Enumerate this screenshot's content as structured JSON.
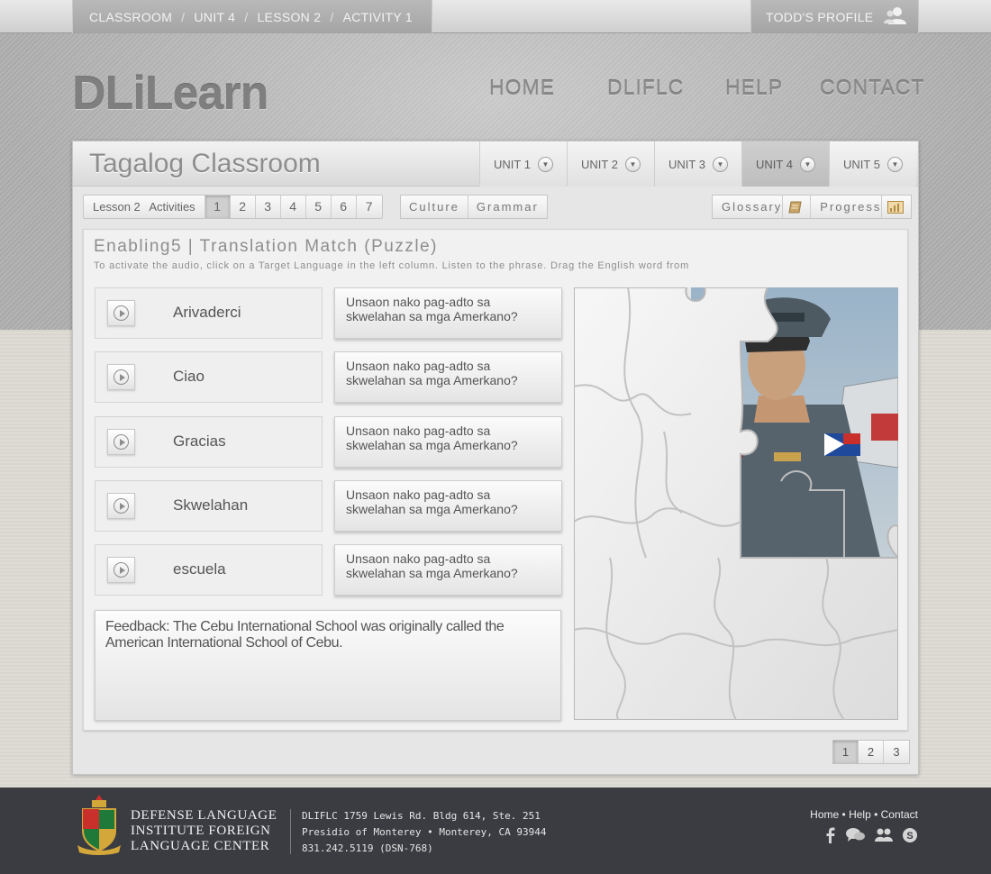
{
  "breadcrumb": {
    "items": [
      "CLASSROOM",
      "UNIT 4",
      "LESSON 2",
      "ACTIVITY 1"
    ],
    "separator": "/"
  },
  "profile": {
    "label": "TODD'S PROFILE",
    "icon": "user-icon"
  },
  "logo": {
    "text": "DLiLearn"
  },
  "nav": {
    "home": "HOME",
    "dliflc": "DLIFLC",
    "help": "HELP",
    "contact": "CONTACT"
  },
  "classroom": {
    "title": "Tagalog Classroom",
    "units": [
      "UNIT 1",
      "UNIT 2",
      "UNIT 3",
      "UNIT 4",
      "UNIT 5"
    ],
    "active_unit": "UNIT 4"
  },
  "activity_bar": {
    "lesson_label": "Lesson 2",
    "activities_label": "Activities",
    "numbers": [
      "1",
      "2",
      "3",
      "4",
      "5",
      "6",
      "7"
    ],
    "active": "1"
  },
  "tools": {
    "culture": "Culture",
    "grammar": "Grammar",
    "glossary": "Glossary",
    "progress": "Progress"
  },
  "activity": {
    "title": "Enabling5 | Translation Match (Puzzle)",
    "instructions": "To activate the audio, click on a Target Language in the left column. Listen to the phrase. Drag the English word from",
    "rows": [
      {
        "word": "Arivaderci",
        "phrase": "Unsaon nako pag-adto sa skwelahan sa mga Amerkano?"
      },
      {
        "word": "Ciao",
        "phrase": "Unsaon nako pag-adto sa skwelahan sa mga Amerkano?"
      },
      {
        "word": "Gracias",
        "phrase": "Unsaon nako pag-adto sa skwelahan sa mga Amerkano?"
      },
      {
        "word": "Skwelahan",
        "phrase": "Unsaon nako pag-adto sa skwelahan sa mga Amerkano?"
      },
      {
        "word": "escuela",
        "phrase": "Unsaon nako pag-adto sa skwelahan sa mga Amerkano?"
      }
    ],
    "feedback": "Feedback: The Cebu International School was originally called the American International School of Cebu."
  },
  "pager": {
    "pages": [
      "1",
      "2",
      "3"
    ],
    "active": "1"
  },
  "footer": {
    "institute": [
      "DEFENSE LANGUAGE",
      "INSTITUTE FOREIGN",
      "LANGUAGE CENTER"
    ],
    "address": [
      "DLIFLC 1759 Lewis Rd. Bldg 614, Ste. 251",
      "Presidio of Monterey • Monterey, CA 93944",
      "831.242.5119 (DSN-768)"
    ],
    "links": [
      "Home",
      "Help",
      "Contact"
    ],
    "link_separator": "•",
    "social_icons": [
      "facebook-icon",
      "chat-icon",
      "group-icon",
      "skype-icon"
    ]
  },
  "colors": {
    "footer_bg": "#3b3c42",
    "header_pattern": "#b0b0b0",
    "panel_bg": "#e6e6e6"
  }
}
